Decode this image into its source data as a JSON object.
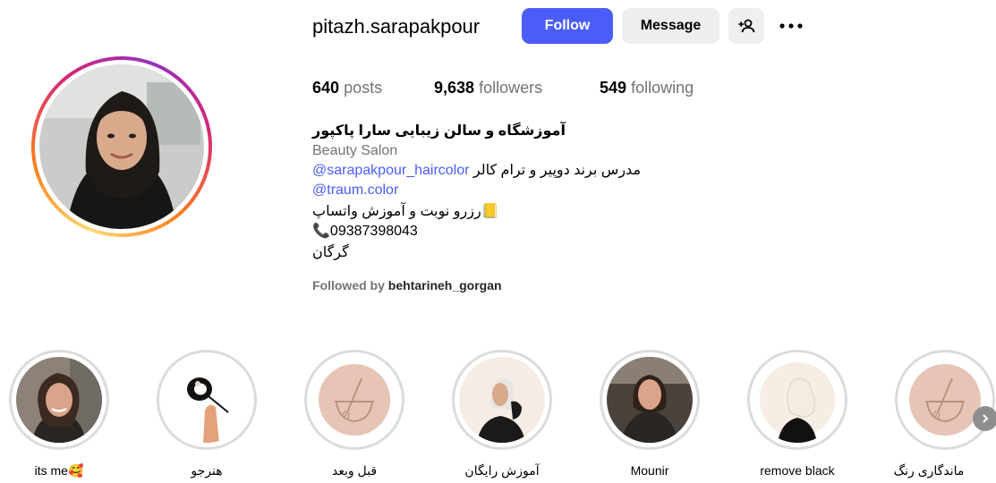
{
  "profile": {
    "username": "pitazh.sarapakpour",
    "follow_label": "Follow",
    "message_label": "Message"
  },
  "stats": {
    "posts_count": "640",
    "posts_label": "posts",
    "followers_count": "9,638",
    "followers_label": "followers",
    "following_count": "549",
    "following_label": "following"
  },
  "bio": {
    "name": "آموزشگاه و سالن زیبایی سارا پاکپور",
    "category": "Beauty Salon",
    "line3_link": "@sarapakpour_haircolor",
    "line3_text": "مدرس برند دوپیر و ترام کالر",
    "line4_link": "@traum.color",
    "line5_text": "رزرو نوبت و آموزش واتساپ",
    "line5_emoji": "📒",
    "line6_emoji": "📞",
    "line6_text": "09387398043",
    "line7_text": "گرگان",
    "followed_prefix": "Followed by",
    "followed_by": "behtarineh_gorgan"
  },
  "highlights": [
    {
      "label": "its me🥰",
      "thumb": "woman-portrait"
    },
    {
      "label": "هنرجو",
      "thumb": "hand-mirror-drawing"
    },
    {
      "label": "قبل وبعد",
      "thumb": "hair-dye-bowl-icon"
    },
    {
      "label": "آموزش رایگان",
      "thumb": "woman-illustration"
    },
    {
      "label": "Mounir",
      "thumb": "woman-photo"
    },
    {
      "label": "remove black",
      "thumb": "blonde-woman-illustration"
    },
    {
      "label": "ماندگاری رنگ",
      "thumb": "hair-dye-bowl-icon"
    }
  ],
  "colors": {
    "accent_blue": "#4a5df9",
    "secondary_button": "#efefef",
    "muted_text": "#737373",
    "highlight_thumb_bg": "#e6c4b6"
  }
}
